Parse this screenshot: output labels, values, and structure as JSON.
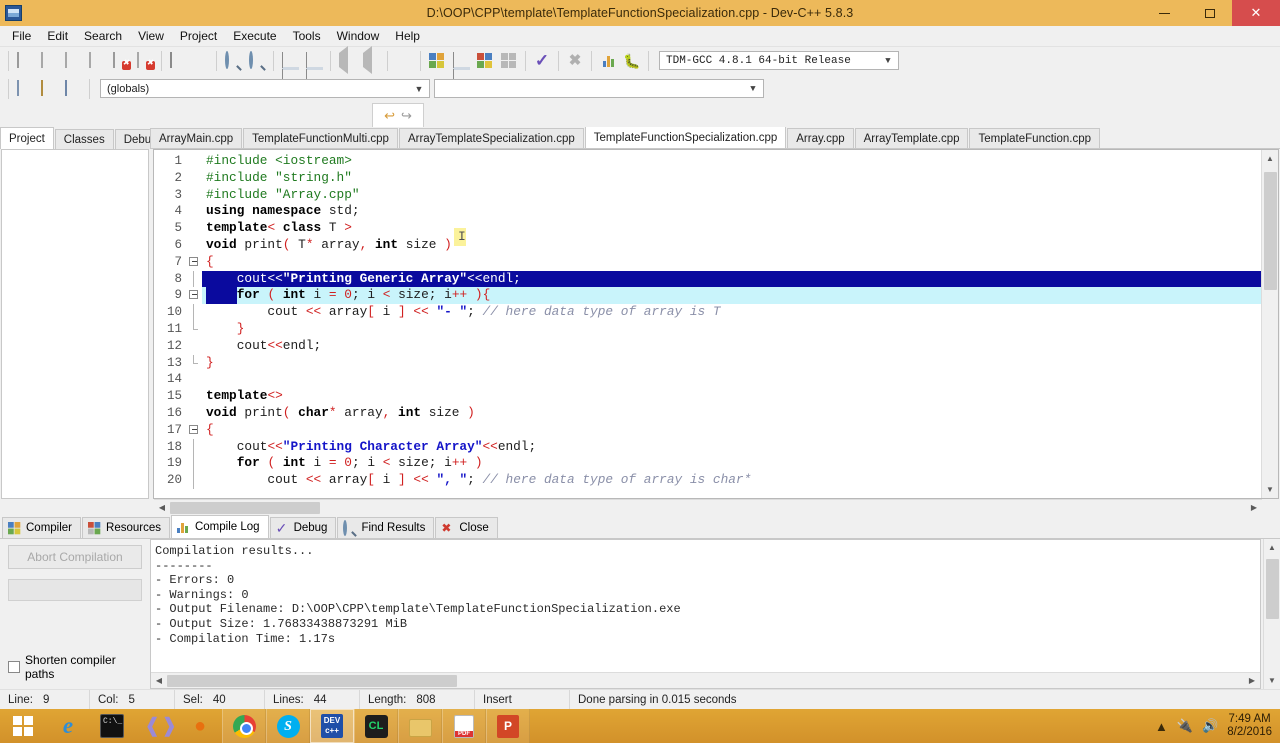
{
  "window": {
    "title": "D:\\OOP\\CPP\\template\\TemplateFunctionSpecialization.cpp - Dev-C++ 5.8.3",
    "icon": "devcpp-icon",
    "minimize": "minimize-button",
    "maximize": "maximize-button",
    "close": "✕"
  },
  "menu": {
    "items": [
      "File",
      "Edit",
      "Search",
      "View",
      "Project",
      "Execute",
      "Tools",
      "Window",
      "Help"
    ]
  },
  "toolbar": {
    "compiler_set": "TDM-GCC 4.8.1 64-bit Release",
    "scope": "(globals)",
    "scope_member": "",
    "undo_label": "↩",
    "redo_label": "↪"
  },
  "left_panel": {
    "tabs": [
      "Project",
      "Classes",
      "Debug"
    ],
    "active_tab": "Project"
  },
  "editor": {
    "tabs": [
      "ArrayMain.cpp",
      "TemplateFunctionMulti.cpp",
      "ArrayTemplateSpecialization.cpp",
      "TemplateFunctionSpecialization.cpp",
      "Array.cpp",
      "ArrayTemplate.cpp",
      "TemplateFunction.cpp"
    ],
    "active_tab": "TemplateFunctionSpecialization.cpp",
    "lines": [
      {
        "n": 1,
        "fold": "",
        "state": "",
        "tokens": [
          {
            "t": "#include ",
            "c": "pre"
          },
          {
            "t": "<iostream>",
            "c": "pre"
          }
        ]
      },
      {
        "n": 2,
        "fold": "",
        "state": "",
        "tokens": [
          {
            "t": "#include ",
            "c": "pre"
          },
          {
            "t": "\"string.h\"",
            "c": "pre"
          }
        ]
      },
      {
        "n": 3,
        "fold": "",
        "state": "",
        "tokens": [
          {
            "t": "#include ",
            "c": "pre"
          },
          {
            "t": "\"Array.cpp\"",
            "c": "pre"
          }
        ]
      },
      {
        "n": 4,
        "fold": "",
        "state": "",
        "tokens": [
          {
            "t": "using namespace ",
            "c": "kw"
          },
          {
            "t": "std",
            "c": "plain"
          },
          {
            "t": ";",
            "c": "plain"
          }
        ]
      },
      {
        "n": 5,
        "fold": "",
        "state": "",
        "tokens": [
          {
            "t": "template",
            "c": "kw"
          },
          {
            "t": "<",
            "c": "sym"
          },
          {
            "t": " ",
            "c": "plain"
          },
          {
            "t": "class",
            "c": "kw"
          },
          {
            "t": " T ",
            "c": "plain"
          },
          {
            "t": ">",
            "c": "sym"
          }
        ]
      },
      {
        "n": 6,
        "fold": "",
        "state": "",
        "tokens": [
          {
            "t": "void",
            "c": "kw"
          },
          {
            "t": " print",
            "c": "plain"
          },
          {
            "t": "(",
            "c": "sym"
          },
          {
            "t": " T",
            "c": "plain"
          },
          {
            "t": "*",
            "c": "sym"
          },
          {
            "t": " array",
            "c": "plain"
          },
          {
            "t": ",",
            "c": "sym"
          },
          {
            "t": " ",
            "c": "plain"
          },
          {
            "t": "int",
            "c": "kw"
          },
          {
            "t": " size ",
            "c": "plain"
          },
          {
            "t": ")",
            "c": "sym"
          }
        ]
      },
      {
        "n": 7,
        "fold": "start",
        "state": "",
        "tokens": [
          {
            "t": "{",
            "c": "sym"
          }
        ]
      },
      {
        "n": 8,
        "fold": "bar",
        "state": "selected",
        "tokens": [
          {
            "t": "    cout",
            "c": "plain"
          },
          {
            "t": "<<",
            "c": "sym"
          },
          {
            "t": "\"Printing Generic Array\"",
            "c": "str"
          },
          {
            "t": "<<",
            "c": "sym"
          },
          {
            "t": "endl;",
            "c": "plain"
          }
        ]
      },
      {
        "n": 9,
        "fold": "start",
        "state": "current",
        "selpad": "    ",
        "tokens": [
          {
            "t": "for",
            "c": "kw"
          },
          {
            "t": " ",
            "c": "plain"
          },
          {
            "t": "(",
            "c": "sym"
          },
          {
            "t": " ",
            "c": "plain"
          },
          {
            "t": "int",
            "c": "kw"
          },
          {
            "t": " i ",
            "c": "plain"
          },
          {
            "t": "=",
            "c": "sym"
          },
          {
            "t": " ",
            "c": "plain"
          },
          {
            "t": "0",
            "c": "num"
          },
          {
            "t": "; i ",
            "c": "plain"
          },
          {
            "t": "<",
            "c": "sym"
          },
          {
            "t": " size; i",
            "c": "plain"
          },
          {
            "t": "++",
            "c": "sym"
          },
          {
            "t": " ",
            "c": "plain"
          },
          {
            "t": ")",
            "c": "sym"
          },
          {
            "t": "{",
            "c": "sym"
          }
        ]
      },
      {
        "n": 10,
        "fold": "bar",
        "state": "",
        "tokens": [
          {
            "t": "        cout ",
            "c": "plain"
          },
          {
            "t": "<<",
            "c": "sym"
          },
          {
            "t": " array",
            "c": "plain"
          },
          {
            "t": "[",
            "c": "sym"
          },
          {
            "t": " i ",
            "c": "plain"
          },
          {
            "t": "]",
            "c": "sym"
          },
          {
            "t": " ",
            "c": "plain"
          },
          {
            "t": "<<",
            "c": "sym"
          },
          {
            "t": " ",
            "c": "plain"
          },
          {
            "t": "\"- \"",
            "c": "str"
          },
          {
            "t": "; ",
            "c": "plain"
          },
          {
            "t": "// here data type of array is T",
            "c": "cmt"
          }
        ]
      },
      {
        "n": 11,
        "fold": "end",
        "state": "",
        "tokens": [
          {
            "t": "    ",
            "c": "plain"
          },
          {
            "t": "}",
            "c": "sym"
          }
        ]
      },
      {
        "n": 12,
        "fold": "",
        "state": "",
        "tokens": [
          {
            "t": "    cout",
            "c": "plain"
          },
          {
            "t": "<<",
            "c": "sym"
          },
          {
            "t": "endl;",
            "c": "plain"
          }
        ]
      },
      {
        "n": 13,
        "fold": "end",
        "state": "",
        "tokens": [
          {
            "t": "}",
            "c": "sym"
          }
        ]
      },
      {
        "n": 14,
        "fold": "",
        "state": "",
        "tokens": []
      },
      {
        "n": 15,
        "fold": "",
        "state": "",
        "tokens": [
          {
            "t": "template",
            "c": "kw"
          },
          {
            "t": "<>",
            "c": "sym"
          }
        ]
      },
      {
        "n": 16,
        "fold": "",
        "state": "",
        "tokens": [
          {
            "t": "void",
            "c": "kw"
          },
          {
            "t": " print",
            "c": "plain"
          },
          {
            "t": "(",
            "c": "sym"
          },
          {
            "t": " ",
            "c": "plain"
          },
          {
            "t": "char",
            "c": "kw"
          },
          {
            "t": "*",
            "c": "sym"
          },
          {
            "t": " array",
            "c": "plain"
          },
          {
            "t": ",",
            "c": "sym"
          },
          {
            "t": " ",
            "c": "plain"
          },
          {
            "t": "int",
            "c": "kw"
          },
          {
            "t": " size ",
            "c": "plain"
          },
          {
            "t": ")",
            "c": "sym"
          }
        ]
      },
      {
        "n": 17,
        "fold": "start",
        "state": "",
        "tokens": [
          {
            "t": "{",
            "c": "sym"
          }
        ]
      },
      {
        "n": 18,
        "fold": "bar",
        "state": "",
        "tokens": [
          {
            "t": "    cout",
            "c": "plain"
          },
          {
            "t": "<<",
            "c": "sym"
          },
          {
            "t": "\"Printing Character Array\"",
            "c": "str"
          },
          {
            "t": "<<",
            "c": "sym"
          },
          {
            "t": "endl;",
            "c": "plain"
          }
        ]
      },
      {
        "n": 19,
        "fold": "bar",
        "state": "",
        "tokens": [
          {
            "t": "    ",
            "c": "plain"
          },
          {
            "t": "for",
            "c": "kw"
          },
          {
            "t": " ",
            "c": "plain"
          },
          {
            "t": "(",
            "c": "sym"
          },
          {
            "t": " ",
            "c": "plain"
          },
          {
            "t": "int",
            "c": "kw"
          },
          {
            "t": " i ",
            "c": "plain"
          },
          {
            "t": "=",
            "c": "sym"
          },
          {
            "t": " ",
            "c": "plain"
          },
          {
            "t": "0",
            "c": "num"
          },
          {
            "t": "; i ",
            "c": "plain"
          },
          {
            "t": "<",
            "c": "sym"
          },
          {
            "t": " size; i",
            "c": "plain"
          },
          {
            "t": "++",
            "c": "sym"
          },
          {
            "t": " ",
            "c": "plain"
          },
          {
            "t": ")",
            "c": "sym"
          }
        ]
      },
      {
        "n": 20,
        "fold": "bar",
        "state": "",
        "tokens": [
          {
            "t": "        cout ",
            "c": "plain"
          },
          {
            "t": "<<",
            "c": "sym"
          },
          {
            "t": " array",
            "c": "plain"
          },
          {
            "t": "[",
            "c": "sym"
          },
          {
            "t": " i ",
            "c": "plain"
          },
          {
            "t": "]",
            "c": "sym"
          },
          {
            "t": " ",
            "c": "plain"
          },
          {
            "t": "<<",
            "c": "sym"
          },
          {
            "t": " ",
            "c": "plain"
          },
          {
            "t": "\", \"",
            "c": "str"
          },
          {
            "t": "; ",
            "c": "plain"
          },
          {
            "t": "// here data type of array is char*",
            "c": "cmt"
          }
        ]
      }
    ]
  },
  "bottom_panel": {
    "tabs": [
      {
        "label": "Compiler",
        "icon": "compiler-icon"
      },
      {
        "label": "Resources",
        "icon": "resources-icon"
      },
      {
        "label": "Compile Log",
        "icon": "compile-log-icon"
      },
      {
        "label": "Debug",
        "icon": "debug-check-icon"
      },
      {
        "label": "Find Results",
        "icon": "find-results-icon"
      },
      {
        "label": "Close",
        "icon": "close-red-icon"
      }
    ],
    "active_tab": "Compile Log",
    "abort_button": "Abort Compilation",
    "shorten_paths_label": "Shorten compiler paths",
    "shorten_paths_checked": false,
    "log_lines": [
      "Compilation results...",
      "--------",
      "- Errors: 0",
      "- Warnings: 0",
      "- Output Filename: D:\\OOP\\CPP\\template\\TemplateFunctionSpecialization.exe",
      "- Output Size: 1.76833438873291 MiB",
      "- Compilation Time: 1.17s"
    ]
  },
  "status_bar": {
    "line_label": "Line:",
    "line_value": "9",
    "col_label": "Col:",
    "col_value": "5",
    "sel_label": "Sel:",
    "sel_value": "40",
    "lines_label": "Lines:",
    "lines_value": "44",
    "length_label": "Length:",
    "length_value": "808",
    "mode": "Insert",
    "message": "Done parsing in 0.015 seconds"
  },
  "taskbar": {
    "start": "start-button",
    "apps": [
      {
        "name": "internet-explorer",
        "glyph": "e",
        "state": "pinned"
      },
      {
        "name": "command-prompt",
        "glyph": "C:\\_",
        "state": "pinned"
      },
      {
        "name": "dolphin",
        "glyph": "ὂc",
        "state": "pinned"
      },
      {
        "name": "firefox",
        "glyph": "●",
        "state": "pinned"
      },
      {
        "name": "google-chrome",
        "glyph": "",
        "state": "open"
      },
      {
        "name": "skype",
        "glyph": "S",
        "state": "open"
      },
      {
        "name": "dev-cpp",
        "glyph": "DEV",
        "state": "active"
      },
      {
        "name": "clion",
        "glyph": "CL",
        "state": "open"
      },
      {
        "name": "file-explorer",
        "glyph": "",
        "state": "open"
      },
      {
        "name": "pdf-reader",
        "glyph": "PDF",
        "state": "open"
      },
      {
        "name": "powerpoint",
        "glyph": "P",
        "state": "open"
      }
    ],
    "tray": {
      "show_hidden": "▲",
      "network": "network-icon",
      "volume": "volume-icon",
      "time": "7:49 AM",
      "date": "8/2/2016"
    }
  },
  "colors": {
    "title_bar": "#edb95a",
    "taskbar": "#d99b27",
    "selection": "#0a0a9e",
    "current_line": "#c9f4fb",
    "close_button": "#d64d4d"
  }
}
